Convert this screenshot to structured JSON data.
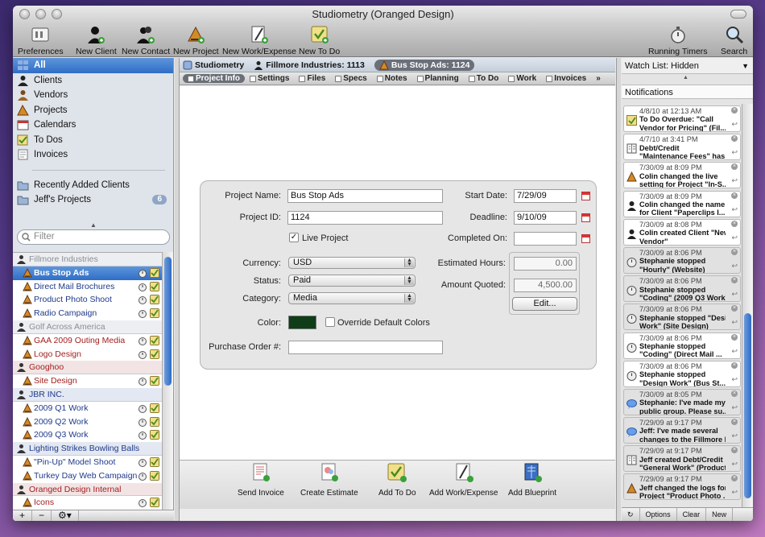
{
  "window": {
    "title": "Studiometry (Oranged Design)"
  },
  "toolbar": {
    "items": [
      {
        "label": "Preferences",
        "icon": "preferences-icon"
      },
      {
        "label": "New Client",
        "icon": "new-client-icon"
      },
      {
        "label": "New Contact",
        "icon": "new-contact-icon"
      },
      {
        "label": "New Project",
        "icon": "new-project-icon"
      },
      {
        "label": "New Work/Expense",
        "icon": "new-work-expense-icon"
      },
      {
        "label": "New To Do",
        "icon": "new-todo-icon"
      },
      {
        "label": "Running Timers",
        "icon": "stopwatch-icon"
      },
      {
        "label": "Search",
        "icon": "magnifier-icon"
      }
    ]
  },
  "sidebar": {
    "sources": [
      {
        "label": "All"
      },
      {
        "label": "Clients"
      },
      {
        "label": "Vendors"
      },
      {
        "label": "Projects"
      },
      {
        "label": "Calendars"
      },
      {
        "label": "To Dos"
      },
      {
        "label": "Invoices"
      }
    ],
    "smart": [
      {
        "label": "Recently Added Clients",
        "badge": ""
      },
      {
        "label": "Jeff's Projects",
        "badge": "6"
      }
    ],
    "filter_placeholder": "Filter",
    "groups": [
      {
        "name": "Fillmore Industries",
        "style": "gray",
        "rows": [
          {
            "label": "Bus Stop Ads",
            "selected": true
          },
          {
            "label": "Direct Mail Brochures"
          },
          {
            "label": "Product Photo Shoot"
          },
          {
            "label": "Radio Campaign"
          }
        ]
      },
      {
        "name": "Golf Across America",
        "style": "gray",
        "rows": [
          {
            "label": "GAA 2009 Outing Media",
            "red": true
          },
          {
            "label": "Logo Design",
            "red": true
          }
        ]
      },
      {
        "name": "Googhoo",
        "style": "red",
        "rows": [
          {
            "label": "Site Design",
            "red": true
          }
        ]
      },
      {
        "name": "JBR INC.",
        "style": "blue",
        "rows": [
          {
            "label": "2009 Q1 Work"
          },
          {
            "label": "2009 Q2 Work"
          },
          {
            "label": "2009 Q3 Work"
          }
        ]
      },
      {
        "name": "Lighting Strikes Bowling Balls",
        "style": "blue",
        "rows": [
          {
            "label": "\"Pin-Up\" Model Shoot"
          },
          {
            "label": "Turkey Day Web Campaign"
          }
        ]
      },
      {
        "name": "Oranged Design Internal",
        "style": "red",
        "rows": [
          {
            "label": "Icons",
            "red": true
          }
        ]
      }
    ],
    "bottom": [
      "+",
      "−",
      "⚙▾"
    ]
  },
  "breadcrumb": {
    "root": "Studiometry",
    "client": "Fillmore Industries: 1113",
    "project": "Bus Stop Ads: 1124"
  },
  "tabs": [
    "Project Info",
    "Settings",
    "Files",
    "Specs",
    "Notes",
    "Planning",
    "To Do",
    "Work",
    "Invoices"
  ],
  "form": {
    "project_name_label": "Project Name:",
    "project_name": "Bus Stop Ads",
    "project_id_label": "Project ID:",
    "project_id": "1124",
    "live_project_label": "Live Project",
    "currency_label": "Currency:",
    "currency": "USD",
    "status_label": "Status:",
    "status": "Paid",
    "category_label": "Category:",
    "category": "Media",
    "color_label": "Color:",
    "color_value": "#0e3d17",
    "override_label": "Override Default Colors",
    "po_label": "Purchase Order #:",
    "po_value": "",
    "start_date_label": "Start Date:",
    "start_date": "7/29/09",
    "deadline_label": "Deadline:",
    "deadline": "9/10/09",
    "completed_label": "Completed On:",
    "completed": "",
    "est_hours_label": "Estimated Hours:",
    "est_hours": "0.00",
    "amount_label": "Amount Quoted:",
    "amount": "4,500.00",
    "edit_label": "Edit..."
  },
  "actions": [
    "Send Invoice",
    "Create Estimate",
    "Add To Do",
    "Add Work/Expense",
    "Add Blueprint"
  ],
  "rightpanel": {
    "watch_label": "Watch List: Hidden",
    "notifications_label": "Notifications",
    "notes": [
      {
        "date": "4/8/10 at 12:13 AM",
        "text": [
          "To Do Overdue: \"Call",
          "Vendor for Pricing\" (Fil..."
        ],
        "icon": "todo",
        "gray": false
      },
      {
        "date": "4/7/10 at 3:41 PM",
        "text": [
          "Debt/Credit",
          "\"Maintenance Fees\" has..."
        ],
        "icon": "ledger",
        "gray": false
      },
      {
        "date": "7/30/09 at 8:09 PM",
        "text": [
          "Colin changed the live",
          "setting for Project \"In-S..."
        ],
        "icon": "project",
        "gray": false
      },
      {
        "date": "7/30/09 at 8:09 PM",
        "text": [
          "Colin changed the name",
          "for Client \"Paperclips I..."
        ],
        "icon": "client",
        "gray": false
      },
      {
        "date": "7/30/09 at 8:08 PM",
        "text": [
          "Colin created Client \"New",
          "Vendor\""
        ],
        "icon": "client",
        "gray": false
      },
      {
        "date": "7/30/09 at 8:06 PM",
        "text": [
          "Stephanie stopped",
          "\"Hourly\" (Website)"
        ],
        "icon": "timer",
        "gray": true
      },
      {
        "date": "7/30/09 at 8:06 PM",
        "text": [
          "Stephanie stopped",
          "\"Coding\" (2009 Q3 Work)"
        ],
        "icon": "timer",
        "gray": true
      },
      {
        "date": "7/30/09 at 8:06 PM",
        "text": [
          "Stephanie stopped \"Design",
          "Work\" (Site Design)"
        ],
        "icon": "timer",
        "gray": true
      },
      {
        "date": "7/30/09 at 8:06 PM",
        "text": [
          "Stephanie stopped",
          "\"Coding\" (Direct Mail ..."
        ],
        "icon": "timer",
        "gray": false
      },
      {
        "date": "7/30/09 at 8:06 PM",
        "text": [
          "Stephanie stopped",
          "\"Design Work\" (Bus St..."
        ],
        "icon": "timer",
        "gray": false
      },
      {
        "date": "7/30/09 at 8:05 PM",
        "text": [
          "Stephanie: I've made my",
          "public group. Please su..."
        ],
        "icon": "chat",
        "gray": true
      },
      {
        "date": "7/29/09 at 9:17 PM",
        "text": [
          "Jeff: I've made several",
          "changes to the Fillmore P..."
        ],
        "icon": "chat",
        "gray": true
      },
      {
        "date": "7/29/09 at 9:17 PM",
        "text": [
          "Jeff created Debt/Credit",
          "\"General Work\" (Product..."
        ],
        "icon": "ledger",
        "gray": true
      },
      {
        "date": "7/29/09 at 9:17 PM",
        "text": [
          "Jeff changed the logs for",
          "Project \"Product Photo ..."
        ],
        "icon": "project",
        "gray": true
      }
    ],
    "bottom": [
      "↻",
      "Options",
      "Clear",
      "New"
    ]
  }
}
